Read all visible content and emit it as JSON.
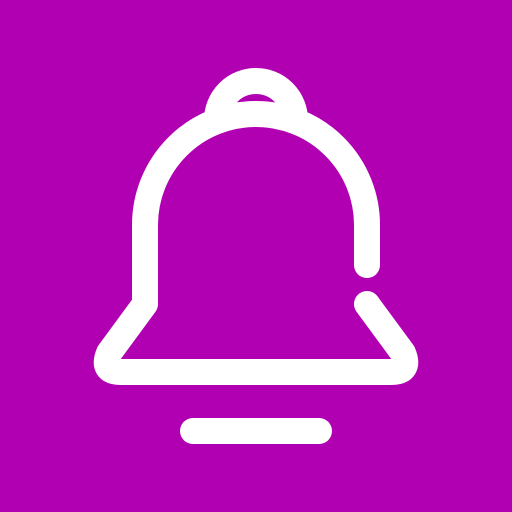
{
  "icon": {
    "name": "bell-icon",
    "background_color": "#b100b1",
    "stroke_color": "#ffffff"
  }
}
